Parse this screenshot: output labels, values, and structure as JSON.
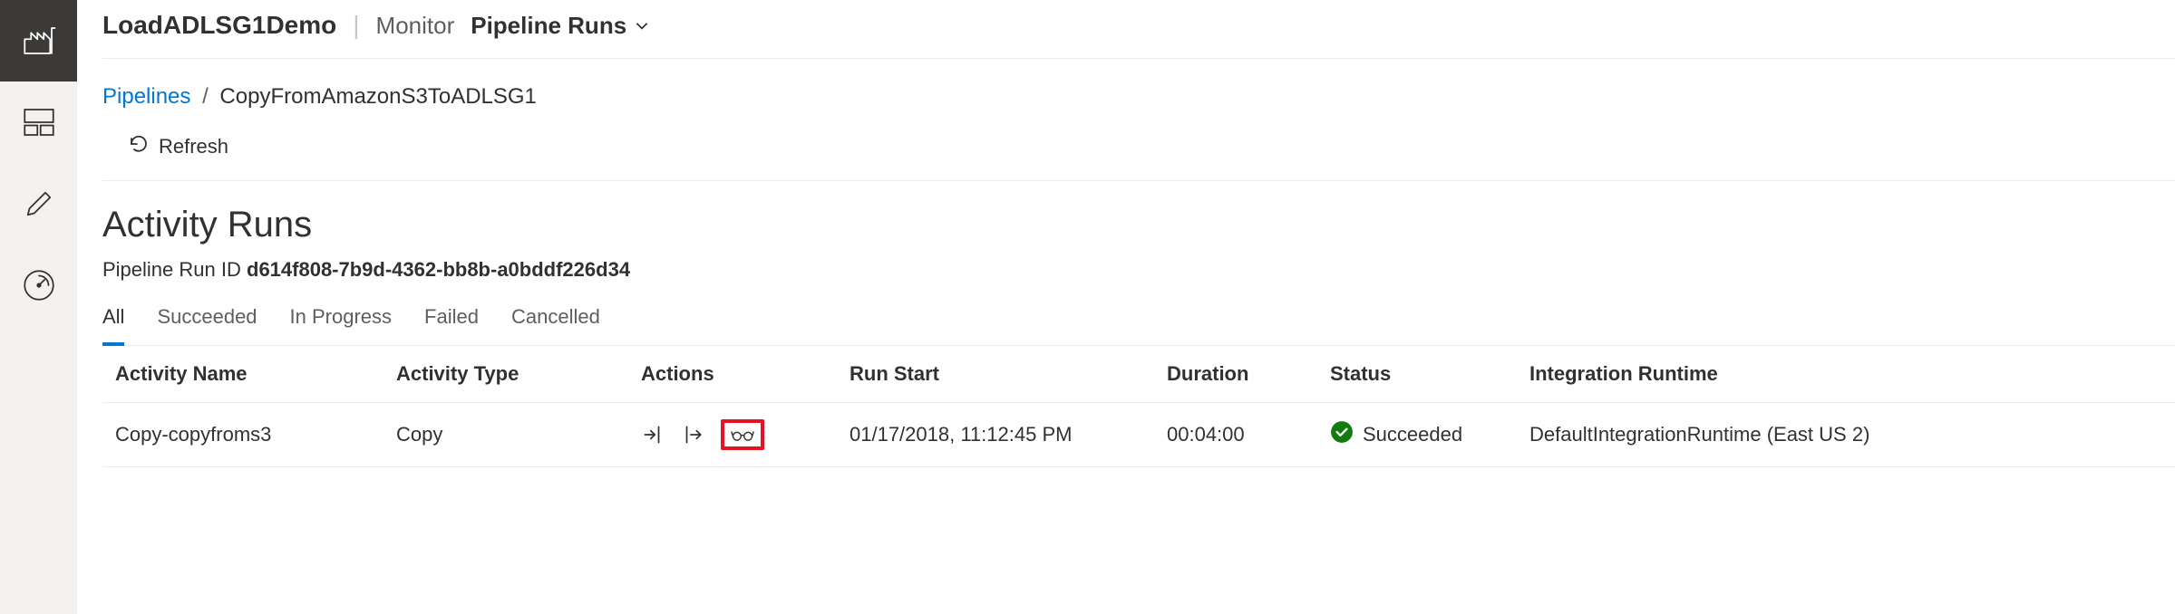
{
  "header": {
    "title": "LoadADLSG1Demo",
    "section": "Monitor",
    "dropdown": "Pipeline Runs"
  },
  "breadcrumb": {
    "root": "Pipelines",
    "separator": "/",
    "current": "CopyFromAmazonS3ToADLSG1"
  },
  "toolbar": {
    "refresh": "Refresh"
  },
  "page": {
    "heading": "Activity Runs",
    "runid_label": "Pipeline Run ID",
    "runid_value": "d614f808-7b9d-4362-bb8b-a0bddf226d34"
  },
  "tabs": {
    "all": "All",
    "succeeded": "Succeeded",
    "inprogress": "In Progress",
    "failed": "Failed",
    "cancelled": "Cancelled"
  },
  "table": {
    "cols": {
      "activity_name": "Activity Name",
      "activity_type": "Activity Type",
      "actions": "Actions",
      "run_start": "Run Start",
      "duration": "Duration",
      "status": "Status",
      "integration_runtime": "Integration Runtime"
    },
    "rows": [
      {
        "activity_name": "Copy-copyfroms3",
        "activity_type": "Copy",
        "run_start": "01/17/2018, 11:12:45 PM",
        "duration": "00:04:00",
        "status": "Succeeded",
        "integration_runtime": "DefaultIntegrationRuntime (East US 2)"
      }
    ]
  }
}
